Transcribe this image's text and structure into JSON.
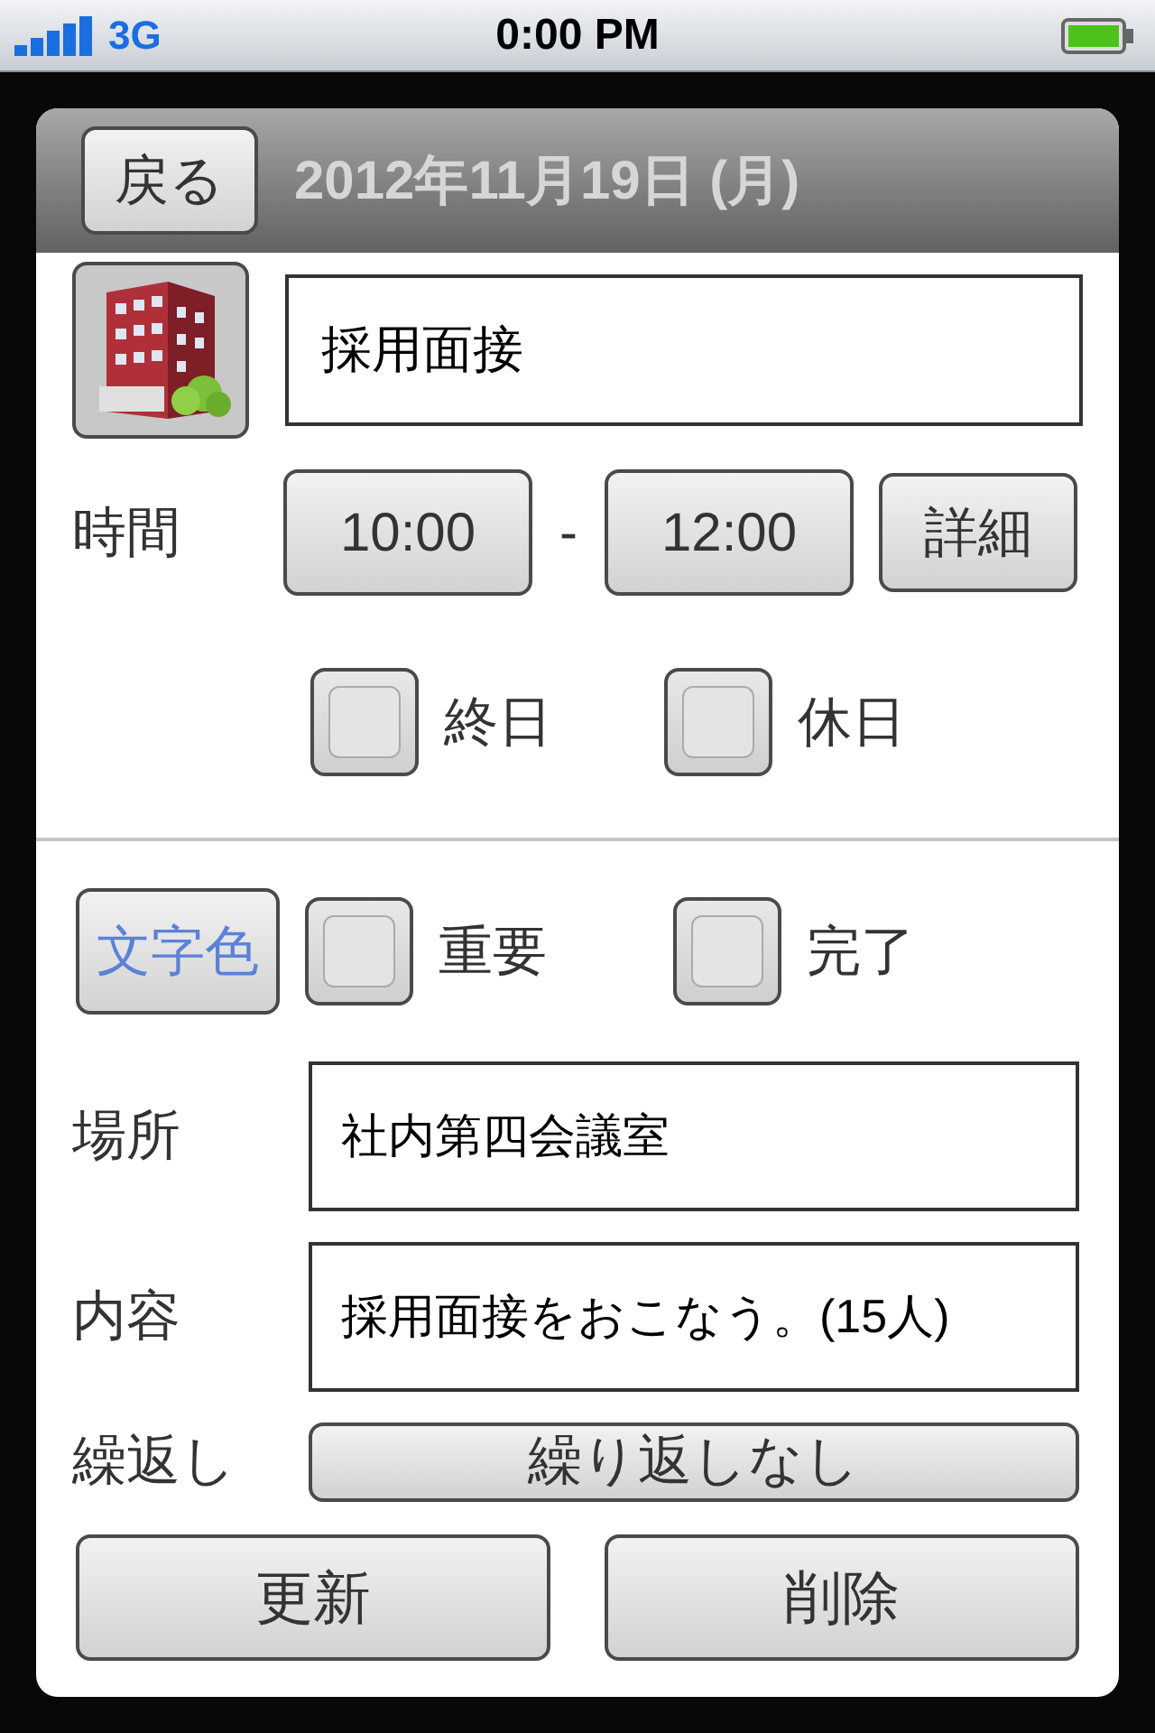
{
  "status_bar": {
    "network": "3G",
    "time": "0:00 PM"
  },
  "header": {
    "back_button": "戻る",
    "title": "2012年11月19日 (月)"
  },
  "title_field": {
    "value": "採用面接"
  },
  "time": {
    "label": "時間",
    "start": "10:00",
    "separator": "-",
    "end": "12:00",
    "detail_button": "詳細"
  },
  "day_options": [
    {
      "label": "終日",
      "checked": false
    },
    {
      "label": "休日",
      "checked": false
    }
  ],
  "text_color_button": "文字色",
  "flags": [
    {
      "label": "重要",
      "checked": false
    },
    {
      "label": "完了",
      "checked": false
    }
  ],
  "fields": [
    {
      "label": "場所",
      "value": "社内第四会議室"
    },
    {
      "label": "内容",
      "value": "採用面接をおこなう。(15人)"
    }
  ],
  "repeat": {
    "label": "繰返し",
    "value": "繰り返しなし"
  },
  "actions": [
    "更新",
    "削除"
  ]
}
